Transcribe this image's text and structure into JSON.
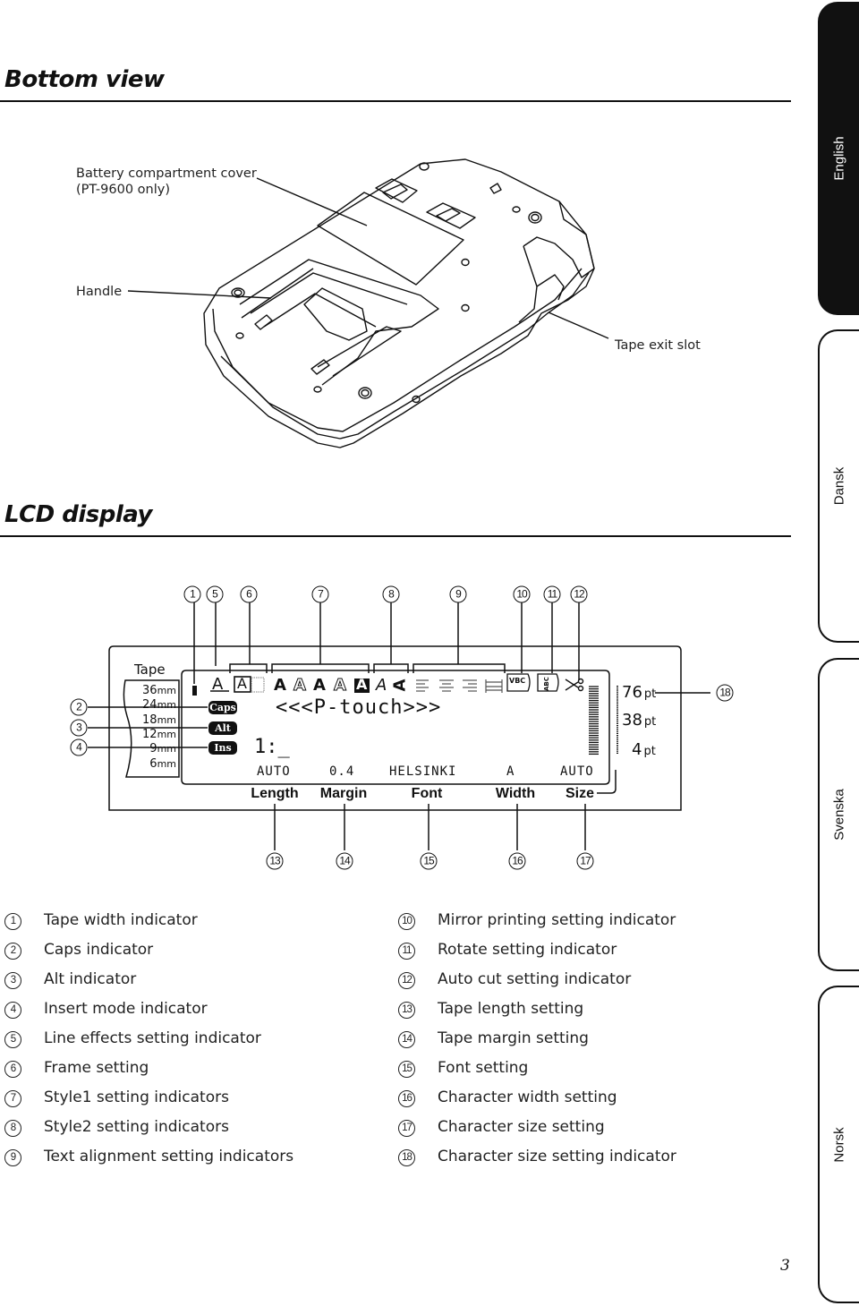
{
  "sections": {
    "bottom_view_title": "Bottom view",
    "lcd_title": "LCD display"
  },
  "bottom_view": {
    "callouts": {
      "battery_line1": "Battery compartment cover",
      "battery_line2": "(PT-9600 only)",
      "handle": "Handle",
      "tape_exit": "Tape exit slot"
    }
  },
  "side_tabs": [
    {
      "label": "English",
      "active": true
    },
    {
      "label": "Dansk",
      "active": false
    },
    {
      "label": "Svenska",
      "active": false
    },
    {
      "label": "Norsk",
      "active": false
    }
  ],
  "lcd": {
    "tape_label": "Tape",
    "tape_widths": [
      {
        "value": "36",
        "unit": "mm"
      },
      {
        "value": "24",
        "unit": "mm"
      },
      {
        "value": "18",
        "unit": "mm"
      },
      {
        "value": "12",
        "unit": "mm"
      },
      {
        "value": "9",
        "unit": "mm"
      },
      {
        "value": "6",
        "unit": "mm"
      }
    ],
    "indicators": {
      "caps": "Caps",
      "alt": "Alt",
      "ins": "Ins"
    },
    "style_glyphs": {
      "line_effect": "A",
      "frame": "A",
      "style1": [
        "A",
        "A",
        "A",
        "A",
        "A"
      ],
      "style2_italic": "A",
      "style2_vertical": "A",
      "mirror": "VBC",
      "rotate": "ABC",
      "cut": "✂"
    },
    "text_line1": "<<<P-touch>>>",
    "text_line2": "1:_",
    "status_values": {
      "length": "AUTO",
      "margin": "0.4",
      "font": "HELSINKI",
      "width": "A",
      "size": "AUTO"
    },
    "status_labels": {
      "length": "Length",
      "margin": "Margin",
      "font": "Font",
      "width": "Width",
      "size": "Size"
    },
    "size_scale": [
      {
        "value": "76",
        "unit": "pt"
      },
      {
        "value": "38",
        "unit": "pt"
      },
      {
        "value": "4",
        "unit": "pt"
      }
    ],
    "callout_numbers": {
      "top": [
        "1",
        "5",
        "6",
        "7",
        "8",
        "9",
        "10",
        "11",
        "12"
      ],
      "left": [
        "2",
        "3",
        "4"
      ],
      "bottom": [
        "13",
        "14",
        "15",
        "16",
        "17"
      ],
      "right": [
        "18"
      ]
    }
  },
  "legend": {
    "left": [
      {
        "num": "1",
        "text": "Tape width indicator"
      },
      {
        "num": "2",
        "text": "Caps indicator"
      },
      {
        "num": "3",
        "text": "Alt indicator"
      },
      {
        "num": "4",
        "text": "Insert mode indicator"
      },
      {
        "num": "5",
        "text": "Line effects setting indicator"
      },
      {
        "num": "6",
        "text": "Frame setting"
      },
      {
        "num": "7",
        "text": "Style1 setting indicators"
      },
      {
        "num": "8",
        "text": "Style2 setting indicators"
      },
      {
        "num": "9",
        "text": "Text alignment setting indicators"
      }
    ],
    "right": [
      {
        "num": "10",
        "text": "Mirror printing setting indicator"
      },
      {
        "num": "11",
        "text": "Rotate setting indicator"
      },
      {
        "num": "12",
        "text": "Auto cut setting indicator"
      },
      {
        "num": "13",
        "text": "Tape length setting"
      },
      {
        "num": "14",
        "text": "Tape margin setting"
      },
      {
        "num": "15",
        "text": "Font setting"
      },
      {
        "num": "16",
        "text": "Character width setting"
      },
      {
        "num": "17",
        "text": "Character size setting"
      },
      {
        "num": "18",
        "text": "Character size setting indicator"
      }
    ]
  },
  "page_number": "3"
}
